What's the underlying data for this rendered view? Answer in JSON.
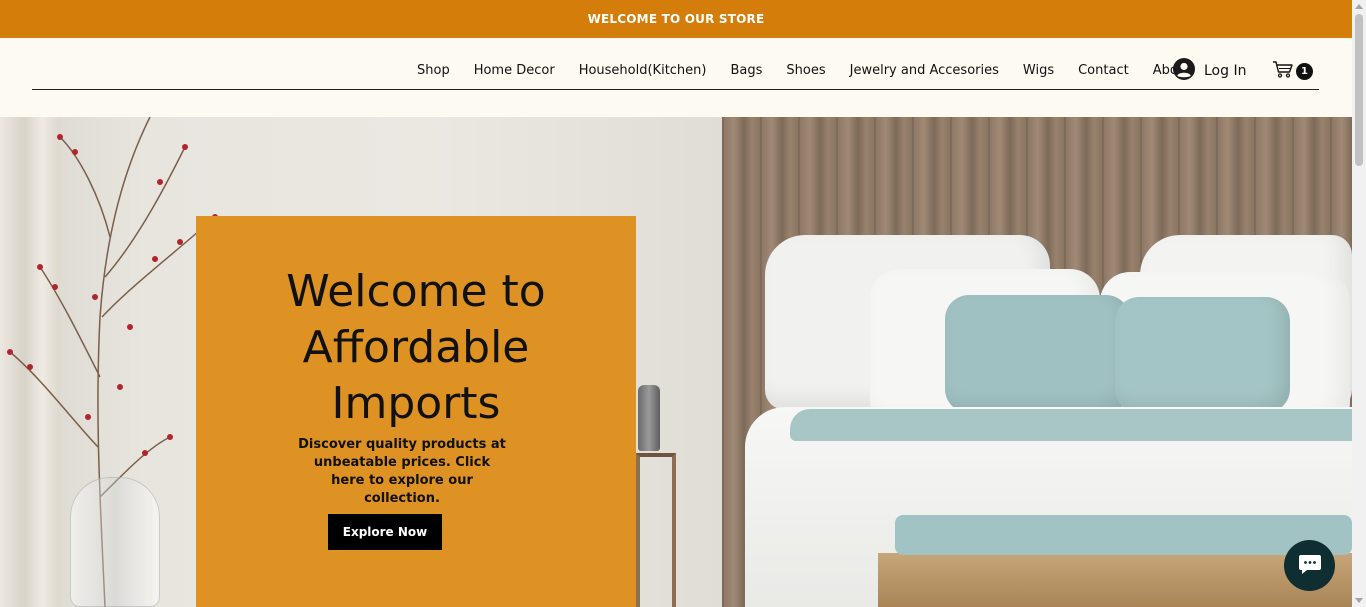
{
  "announcement": "WELCOME TO OUR STORE",
  "nav": {
    "items": [
      {
        "label": "Shop"
      },
      {
        "label": "Home Decor"
      },
      {
        "label": "Household(Kitchen)"
      },
      {
        "label": "Bags"
      },
      {
        "label": "Shoes"
      },
      {
        "label": "Jewelry and Accesories"
      },
      {
        "label": "Wigs"
      },
      {
        "label": "Contact"
      },
      {
        "label": "About"
      }
    ]
  },
  "account": {
    "login_label": "Log In",
    "icon": "user-avatar-icon"
  },
  "cart": {
    "icon": "shopping-cart-icon",
    "count": "1"
  },
  "hero": {
    "title": "Welcome to Affordable Imports",
    "description": "Discover quality products at unbeatable prices. Click here to explore our collection.",
    "button_label": "Explore Now"
  },
  "chat": {
    "icon": "chat-bubble-icon"
  },
  "colors": {
    "announcement_bg": "#d47d0b",
    "card_bg": "#dd9223",
    "header_bg": "#fcfaf1",
    "button_bg": "#000000",
    "chat_bg": "#0f2e32"
  }
}
